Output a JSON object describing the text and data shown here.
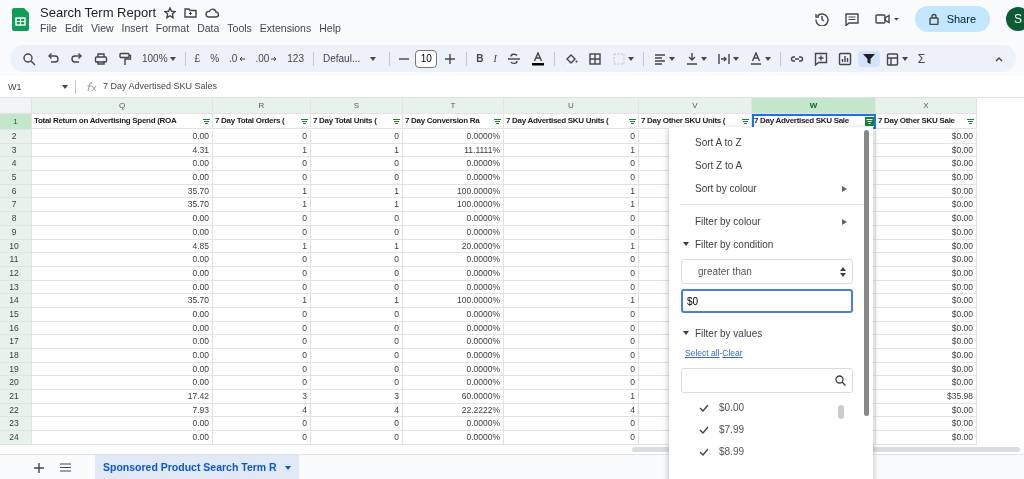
{
  "app": {
    "title": "Search Term Report",
    "menu": [
      "File",
      "Edit",
      "View",
      "Insert",
      "Format",
      "Data",
      "Tools",
      "Extensions",
      "Help"
    ],
    "share": "Share",
    "avatar": "S"
  },
  "toolbar": {
    "zoom": "100%",
    "currency": "£",
    "percent": "%",
    "decrease_decimals": ".0",
    "increase_decimals": ".00",
    "number_format": "123",
    "font": "Defaul...",
    "font_size": "10",
    "bold": "B",
    "italic": "I",
    "functions": "Σ",
    "filter_active": true
  },
  "formula_bar": {
    "cell": "W1",
    "content": "7 Day Advertised SKU Sales"
  },
  "columns": [
    {
      "letter": "Q",
      "title": "Total Return on Advertising Spend (ROA",
      "selected": false,
      "filter_active": false
    },
    {
      "letter": "R",
      "title": "7 Day Total Orders (",
      "selected": false,
      "filter_active": false
    },
    {
      "letter": "S",
      "title": "7 Day Total Units (",
      "selected": false,
      "filter_active": false
    },
    {
      "letter": "T",
      "title": "7 Day Conversion Ra",
      "selected": false,
      "filter_active": false
    },
    {
      "letter": "U",
      "title": "7 Day Advertised SKU Units (",
      "selected": false,
      "filter_active": false
    },
    {
      "letter": "V",
      "title": "7 Day Other SKU Units (",
      "selected": false,
      "filter_active": false
    },
    {
      "letter": "W",
      "title": "7 Day Advertised SKU Sale",
      "selected": true,
      "filter_active": true
    },
    {
      "letter": "X",
      "title": "7 Day Other SKU Sale",
      "selected": false,
      "filter_active": false
    }
  ],
  "header_row": "1",
  "rows": [
    {
      "number": "2",
      "q": "0.00",
      "r": "0",
      "s": "0",
      "t": "0.0000%",
      "u": "0",
      "x": "$0.00"
    },
    {
      "number": "3",
      "q": "4.31",
      "r": "1",
      "s": "1",
      "t": "11.1111%",
      "u": "1",
      "x": "$0.00"
    },
    {
      "number": "4",
      "q": "0.00",
      "r": "0",
      "s": "0",
      "t": "0.0000%",
      "u": "0",
      "x": "$0.00"
    },
    {
      "number": "5",
      "q": "0.00",
      "r": "0",
      "s": "0",
      "t": "0.0000%",
      "u": "0",
      "x": "$0.00"
    },
    {
      "number": "6",
      "q": "35.70",
      "r": "1",
      "s": "1",
      "t": "100.0000%",
      "u": "1",
      "x": "$0.00"
    },
    {
      "number": "7",
      "q": "35.70",
      "r": "1",
      "s": "1",
      "t": "100.0000%",
      "u": "1",
      "x": "$0.00"
    },
    {
      "number": "8",
      "q": "0.00",
      "r": "0",
      "s": "0",
      "t": "0.0000%",
      "u": "0",
      "x": "$0.00"
    },
    {
      "number": "9",
      "q": "0.00",
      "r": "0",
      "s": "0",
      "t": "0.0000%",
      "u": "0",
      "x": "$0.00"
    },
    {
      "number": "10",
      "q": "4.85",
      "r": "1",
      "s": "1",
      "t": "20.0000%",
      "u": "1",
      "x": "$0.00"
    },
    {
      "number": "11",
      "q": "0.00",
      "r": "0",
      "s": "0",
      "t": "0.0000%",
      "u": "0",
      "x": "$0.00"
    },
    {
      "number": "12",
      "q": "0.00",
      "r": "0",
      "s": "0",
      "t": "0.0000%",
      "u": "0",
      "x": "$0.00"
    },
    {
      "number": "13",
      "q": "0.00",
      "r": "0",
      "s": "0",
      "t": "0.0000%",
      "u": "0",
      "x": "$0.00"
    },
    {
      "number": "14",
      "q": "35.70",
      "r": "1",
      "s": "1",
      "t": "100.0000%",
      "u": "1",
      "x": "$0.00"
    },
    {
      "number": "15",
      "q": "0.00",
      "r": "0",
      "s": "0",
      "t": "0.0000%",
      "u": "0",
      "x": "$0.00"
    },
    {
      "number": "16",
      "q": "0.00",
      "r": "0",
      "s": "0",
      "t": "0.0000%",
      "u": "0",
      "x": "$0.00"
    },
    {
      "number": "17",
      "q": "0.00",
      "r": "0",
      "s": "0",
      "t": "0.0000%",
      "u": "0",
      "x": "$0.00"
    },
    {
      "number": "18",
      "q": "0.00",
      "r": "0",
      "s": "0",
      "t": "0.0000%",
      "u": "0",
      "x": "$0.00"
    },
    {
      "number": "19",
      "q": "0.00",
      "r": "0",
      "s": "0",
      "t": "0.0000%",
      "u": "0",
      "x": "$0.00"
    },
    {
      "number": "20",
      "q": "0.00",
      "r": "0",
      "s": "0",
      "t": "0.0000%",
      "u": "0",
      "x": "$0.00"
    },
    {
      "number": "21",
      "q": "17.42",
      "r": "3",
      "s": "3",
      "t": "60.0000%",
      "u": "1",
      "x": "$35.98"
    },
    {
      "number": "22",
      "q": "7.93",
      "r": "4",
      "s": "4",
      "t": "22.2222%",
      "u": "4",
      "x": "$0.00"
    },
    {
      "number": "23",
      "q": "0.00",
      "r": "0",
      "s": "0",
      "t": "0.0000%",
      "u": "0",
      "x": "$0.00"
    },
    {
      "number": "24",
      "q": "0.00",
      "r": "0",
      "s": "0",
      "t": "0.0000%",
      "u": "0",
      "x": "$0.00"
    }
  ],
  "filter_menu": {
    "items": [
      {
        "kind": "item",
        "label": "Sort A to Z",
        "submenu": false
      },
      {
        "kind": "item",
        "label": "Sort Z to A",
        "submenu": false
      },
      {
        "kind": "item",
        "label": "Sort by colour",
        "submenu": true
      },
      {
        "kind": "divider"
      },
      {
        "kind": "item",
        "label": "Filter by colour",
        "submenu": true
      },
      {
        "kind": "section",
        "label": "Filter by condition",
        "expanded": true
      }
    ],
    "condition": "greater than",
    "condition_value": "$0",
    "values_section": {
      "label": "Filter by values",
      "expanded": true
    },
    "links": [
      "Select all",
      "Clear"
    ],
    "link_separator": "-",
    "values": [
      {
        "label": "$0.00",
        "checked": true
      },
      {
        "label": "$7.99",
        "checked": true
      },
      {
        "label": "$8.99",
        "checked": true
      }
    ]
  },
  "sheets": [
    {
      "name": "Sponsored Product Search Term R",
      "selected": true
    }
  ]
}
